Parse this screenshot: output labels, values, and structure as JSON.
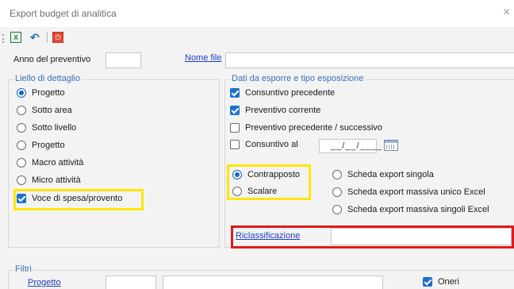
{
  "window": {
    "title": "Export budget di analitica",
    "close_glyph": "×"
  },
  "toolbar": {
    "excel_icon": "excel-export-icon",
    "excel_glyph": "X",
    "undo_icon": "undo-icon",
    "undo_glyph": "↶",
    "power_icon": "power-icon",
    "power_glyph": "⏻"
  },
  "header": {
    "anno_label": "Anno del preventivo",
    "anno_value": "",
    "nome_file_link": "Nome file",
    "nome_file_value": ""
  },
  "livello": {
    "title": "Liello di dettaglio",
    "options": [
      {
        "label": "Progetto",
        "selected": true
      },
      {
        "label": "Sotto area",
        "selected": false
      },
      {
        "label": "Sotto livello",
        "selected": false
      },
      {
        "label": "Progetto",
        "selected": false
      },
      {
        "label": "Macro attività",
        "selected": false
      },
      {
        "label": "Micro attività",
        "selected": false
      }
    ],
    "voce_label": "Voce di spesa/provento",
    "voce_checked": true
  },
  "dati": {
    "title": "Dati da esporre e tipo esposizione",
    "checks": [
      {
        "label": "Consuntivo precedente",
        "checked": true
      },
      {
        "label": "Preventivo corrente",
        "checked": true
      },
      {
        "label": "Preventivo precedente / successivo",
        "checked": false
      },
      {
        "label": "Consuntivo al",
        "checked": false
      }
    ],
    "date_value": "__/__/____",
    "calendar_icon": "calendar-icon",
    "layout": [
      {
        "label": "Contrapposto",
        "selected": true
      },
      {
        "label": "Scalare",
        "selected": false
      }
    ],
    "export": [
      {
        "label": "Scheda export singola",
        "selected": false
      },
      {
        "label": "Scheda export massiva unico Excel",
        "selected": false
      },
      {
        "label": "Scheda export massiva singoli Excel",
        "selected": false
      }
    ],
    "riclassificazione_link": "Riclassificazione",
    "riclassificazione_value": ""
  },
  "filtri": {
    "title": "Filtri",
    "progetto_link": "Progetto",
    "progetto_code": "",
    "progetto_desc": "",
    "oneri_label": "Oneri",
    "oneri_checked": true
  },
  "highlights": {
    "yellow": "#ffe600",
    "red": "#e01b1b"
  }
}
